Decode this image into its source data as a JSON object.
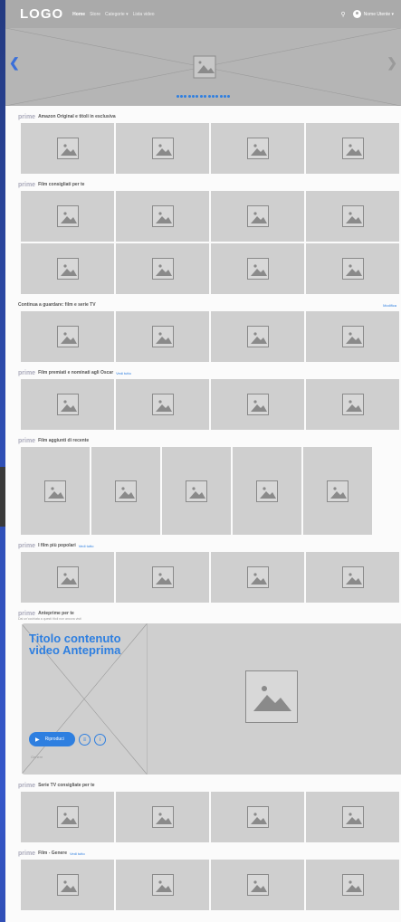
{
  "header": {
    "logo": "LOGO",
    "nav": [
      "Home",
      "Store",
      "Categorie ▾",
      "Lista video"
    ],
    "user": "Nome Utente ▾"
  },
  "hero": {
    "dots": 14
  },
  "sections": [
    {
      "prime": "prime",
      "title": "Amazon Original e titoli in esclusiva",
      "link": ""
    },
    {
      "prime": "prime",
      "title": "Film consigliati per te",
      "link": ""
    },
    {
      "prime": "",
      "title": "Continua a guardare: film e serie TV",
      "link": "",
      "right": "Modifica"
    },
    {
      "prime": "prime",
      "title": "Film premiati e nominati agli Oscar",
      "link": "Vedi tutto"
    },
    {
      "prime": "prime",
      "title": "Film aggiunti di recente",
      "link": ""
    },
    {
      "prime": "prime",
      "title": "I film più popolari",
      "link": "Vedi tutto"
    },
    {
      "prime": "prime",
      "title": "Anteprime per te",
      "link": "",
      "subtitle": "Dai un'occhiata a questi titoli non ancora visti"
    },
    {
      "prime": "prime",
      "title": "Serie TV consigliate per te",
      "link": ""
    },
    {
      "prime": "prime",
      "title": "Film - Genere",
      "link": "Vedi tutto"
    }
  ],
  "preview": {
    "title": "Titolo contenuto video Anteprima",
    "play_label": "Riproduci",
    "genre": "Genere"
  }
}
